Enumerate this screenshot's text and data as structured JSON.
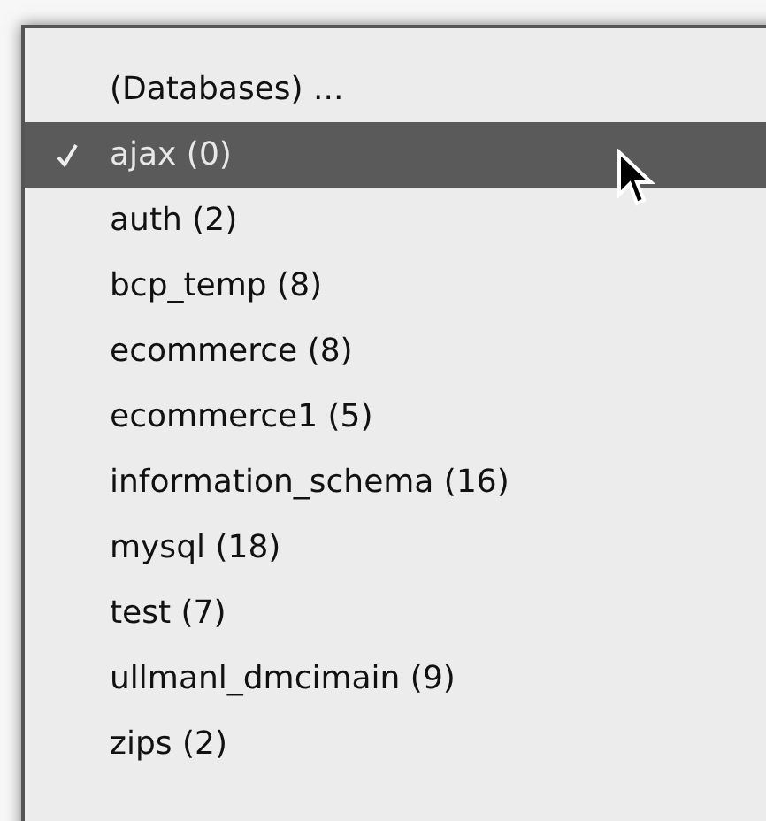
{
  "menu": {
    "items": [
      {
        "label": "(Databases) ...",
        "checked": false,
        "selected": false
      },
      {
        "label": "ajax (0)",
        "checked": true,
        "selected": true
      },
      {
        "label": "auth (2)",
        "checked": false,
        "selected": false
      },
      {
        "label": "bcp_temp (8)",
        "checked": false,
        "selected": false
      },
      {
        "label": "ecommerce (8)",
        "checked": false,
        "selected": false
      },
      {
        "label": "ecommerce1 (5)",
        "checked": false,
        "selected": false
      },
      {
        "label": "information_schema (16)",
        "checked": false,
        "selected": false
      },
      {
        "label": "mysql (18)",
        "checked": false,
        "selected": false
      },
      {
        "label": "test (7)",
        "checked": false,
        "selected": false
      },
      {
        "label": "ullmanl_dmcimain (9)",
        "checked": false,
        "selected": false
      },
      {
        "label": "zips (2)",
        "checked": false,
        "selected": false
      }
    ]
  }
}
